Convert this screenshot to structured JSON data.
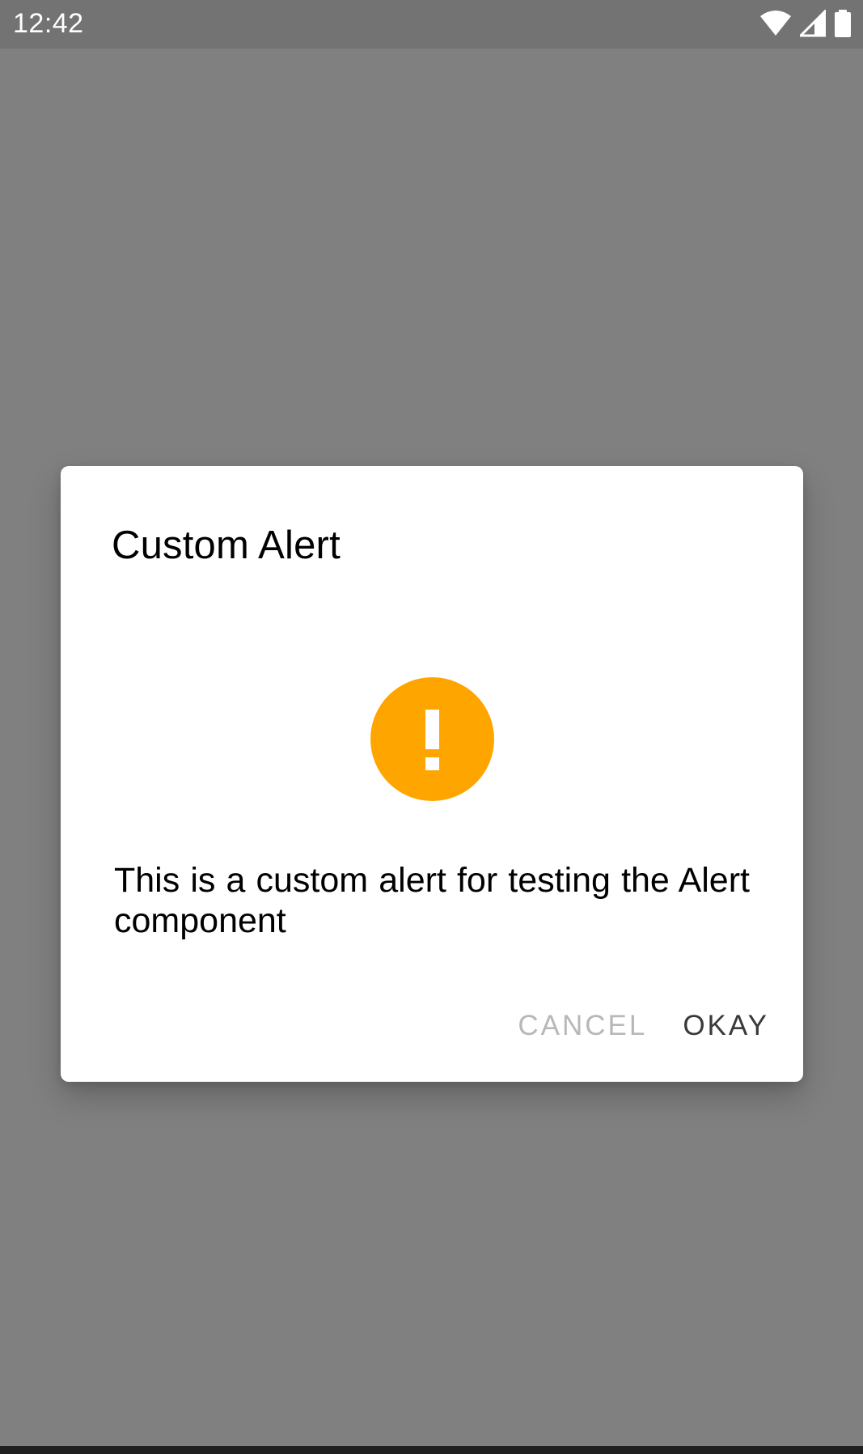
{
  "status_bar": {
    "time": "12:42",
    "icons": [
      "wifi-icon",
      "cellular-signal-icon",
      "battery-icon"
    ]
  },
  "dialog": {
    "title": "Custom Alert",
    "icon": "warning-exclamation-icon",
    "icon_color": "#FFA500",
    "message": "This is a custom alert for testing the Alert component",
    "buttons": {
      "cancel_label": "CANCEL",
      "okay_label": "OKAY"
    }
  },
  "colors": {
    "scrim": "#808080",
    "dialog_background": "#FFFFFF",
    "cancel_text": "#B8B8B8",
    "okay_text": "#3A3A3A"
  }
}
